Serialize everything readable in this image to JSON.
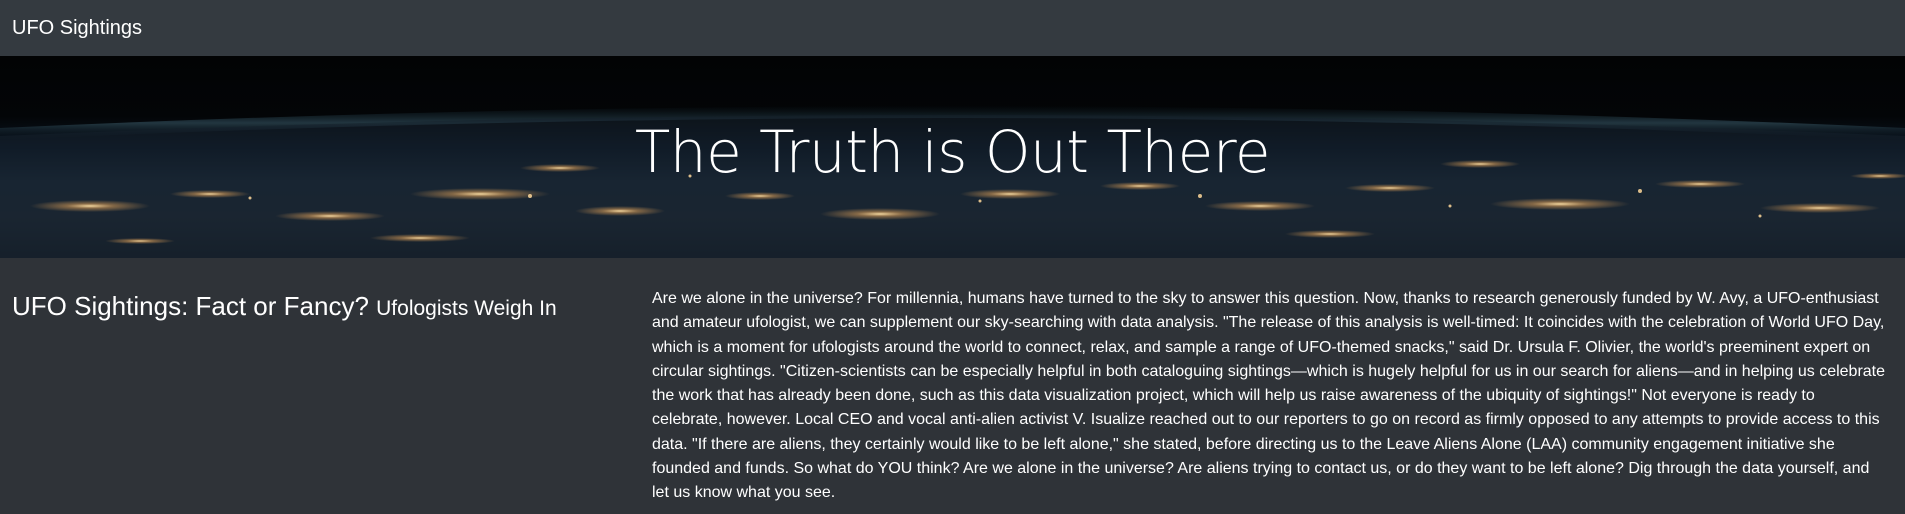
{
  "navbar": {
    "brand": "UFO Sightings"
  },
  "hero": {
    "title": "The Truth is Out There"
  },
  "article": {
    "heading": "UFO Sightings: Fact or Fancy?",
    "subheading": "Ufologists Weigh In",
    "body": "Are we alone in the universe? For millennia, humans have turned to the sky to answer this question. Now, thanks to research generously funded by W. Avy, a UFO-enthusiast and amateur ufologist, we can supplement our sky-searching with data analysis. \"The release of this analysis is well-timed: It coincides with the celebration of World UFO Day, which is a moment for ufologists around the world to connect, relax, and sample a range of UFO-themed snacks,\" said Dr. Ursula F. Olivier, the world's preeminent expert on circular sightings. \"Citizen-scientists can be especially helpful in both cataloguing sightings—which is hugely helpful for us in our search for aliens—and in helping us celebrate the work that has already been done, such as this data visualization project, which will help us raise awareness of the ubiquity of sightings!\" Not everyone is ready to celebrate, however. Local CEO and vocal anti-alien activist V. Isualize reached out to our reporters to go on record as firmly opposed to any attempts to provide access to this data. \"If there are aliens, they certainly would like to be left alone,\" she stated, before directing us to the Leave Aliens Alone (LAA) community engagement initiative she founded and funds. So what do YOU think? Are we alone in the universe? Are aliens trying to contact us, or do they want to be left alone? Dig through the data yourself, and let us know what you see."
  }
}
